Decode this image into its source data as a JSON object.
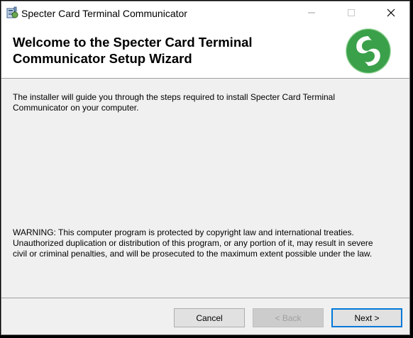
{
  "window": {
    "title": "Specter Card Terminal Communicator"
  },
  "banner": {
    "title": "Welcome to the Specter Card Terminal Communicator Setup Wizard",
    "logo_icon": "specter-swirl-logo",
    "logo_color": "#3aa04a"
  },
  "content": {
    "intro": "The installer will guide you through the steps required to install Specter Card Terminal Communicator on your computer.",
    "warning": "WARNING: This computer program is protected by copyright law and international treaties. Unauthorized duplication or distribution of this program, or any portion of it, may result in severe civil or criminal penalties, and will be prosecuted to the maximum extent possible under the law."
  },
  "buttons": {
    "cancel": "Cancel",
    "back": "< Back",
    "next": "Next >"
  },
  "colors": {
    "accent": "#0078d7",
    "disabled_text": "#a0a0a0"
  }
}
